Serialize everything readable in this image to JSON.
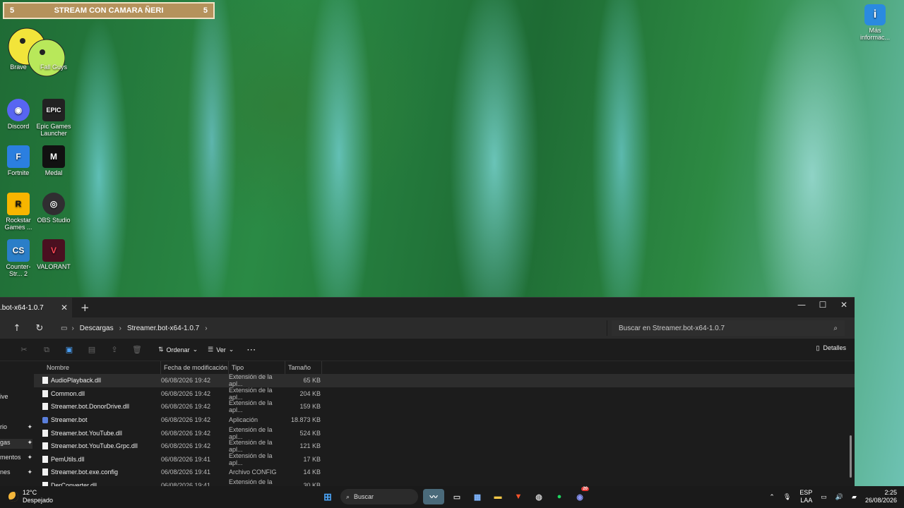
{
  "desktop": {
    "widget": {
      "left_num": "5",
      "title": "STREAM CON CAMARA ÑERI",
      "right_num": "5"
    },
    "icons": [
      {
        "label": "Brave",
        "key": "brave"
      },
      {
        "label": "Fall Guys",
        "key": "fallguys"
      },
      {
        "label": "Discord",
        "key": "discord"
      },
      {
        "label": "Epic Games Launcher",
        "key": "epic"
      },
      {
        "label": "Fortnite",
        "key": "fortnite"
      },
      {
        "label": "Medal",
        "key": "medal"
      },
      {
        "label": "Rockstar Games ...",
        "key": "rockstar"
      },
      {
        "label": "OBS Studio",
        "key": "obs"
      },
      {
        "label": "Counter-Str... 2",
        "key": "cs2"
      },
      {
        "label": "VALORANT",
        "key": "valorant"
      }
    ],
    "info_label": "Más informac..."
  },
  "explorer": {
    "tab_title": ".bot-x64-1.0.7",
    "breadcrumb": [
      "Descargas",
      "Streamer.bot-x64-1.0.7"
    ],
    "search_placeholder": "Buscar en Streamer.bot-x64-1.0.7",
    "toolbar": {
      "sort_label": "Ordenar",
      "view_label": "Ver",
      "details_label": "Detalles"
    },
    "sidebar": [
      {
        "label": "",
        "pinned": false
      },
      {
        "label": "ive",
        "pinned": false
      },
      {
        "label": "rio",
        "pinned": true
      },
      {
        "label": "gas",
        "pinned": true,
        "active": true
      },
      {
        "label": "mentos",
        "pinned": true
      },
      {
        "label": "nes",
        "pinned": true
      }
    ],
    "columns": {
      "name": "Nombre",
      "date": "Fecha de modificación",
      "type": "Tipo",
      "size": "Tamaño"
    },
    "files": [
      {
        "name": "AudioPlayback.dll",
        "date": "06/08/2026 19:42",
        "type": "Extensión de la apl...",
        "size": "65 KB",
        "icon": "file-icon",
        "selected": true
      },
      {
        "name": "Common.dll",
        "date": "06/08/2026 19:42",
        "type": "Extensión de la apl...",
        "size": "204 KB",
        "icon": "file-icon"
      },
      {
        "name": "Streamer.bot.DonorDrive.dll",
        "date": "06/08/2026 19:42",
        "type": "Extensión de la apl...",
        "size": "159 KB",
        "icon": "file-icon"
      },
      {
        "name": "Streamer.bot",
        "date": "06/08/2026 19:42",
        "type": "Aplicación",
        "size": "18.873 KB",
        "icon": "app-icon"
      },
      {
        "name": "Streamer.bot.YouTube.dll",
        "date": "06/08/2026 19:42",
        "type": "Extensión de la apl...",
        "size": "524 KB",
        "icon": "file-icon"
      },
      {
        "name": "Streamer.bot.YouTube.Grpc.dll",
        "date": "06/08/2026 19:42",
        "type": "Extensión de la apl...",
        "size": "121 KB",
        "icon": "file-icon"
      },
      {
        "name": "PemUtils.dll",
        "date": "06/08/2026 19:41",
        "type": "Extensión de la apl...",
        "size": "17 KB",
        "icon": "file-icon"
      },
      {
        "name": "Streamer.bot.exe.config",
        "date": "06/08/2026 19:41",
        "type": "Archivo CONFIG",
        "size": "14 KB",
        "icon": "file-icon"
      },
      {
        "name": "DerConverter.dll",
        "date": "06/08/2026 19:41",
        "type": "Extensión de la apl...",
        "size": "30 KB",
        "icon": "file-icon"
      }
    ]
  },
  "taskbar": {
    "weather_temp": "12°C",
    "weather_desc": "Despejado",
    "search_label": "Buscar",
    "lang_top": "ESP",
    "lang_bottom": "LAA",
    "time": "2:25",
    "date": "26/08/2026",
    "discord_badge": "20"
  },
  "colors": {
    "accent": "#0078d4",
    "widget_bg": "#b5925c",
    "explorer_bg": "#1c1c1c"
  }
}
